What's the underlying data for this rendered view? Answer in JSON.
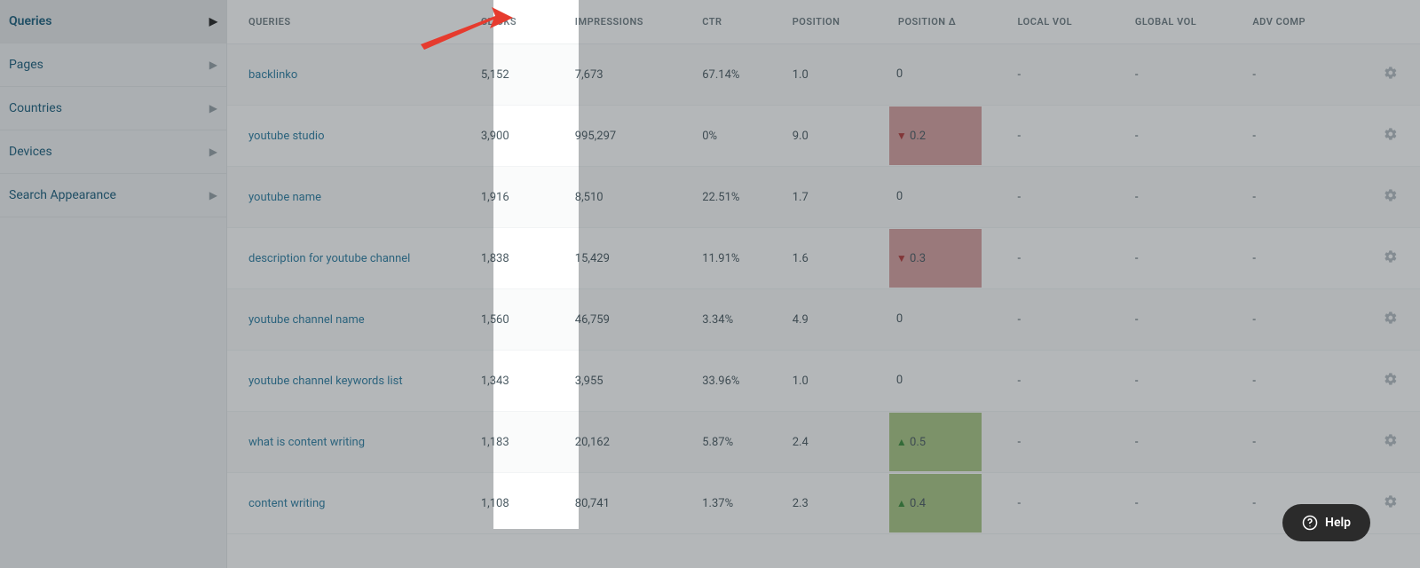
{
  "sidebar": {
    "items": [
      {
        "label": "Queries",
        "active": true
      },
      {
        "label": "Pages",
        "active": false
      },
      {
        "label": "Countries",
        "active": false
      },
      {
        "label": "Devices",
        "active": false
      },
      {
        "label": "Search Appearance",
        "active": false
      }
    ]
  },
  "table": {
    "headers": {
      "queries": "QUERIES",
      "clicks": "CLICKS",
      "impressions": "IMPRESSIONS",
      "ctr": "CTR",
      "position": "POSITION",
      "position_delta": "POSITION Δ",
      "local_vol": "LOCAL VOL",
      "global_vol": "GLOBAL VOL",
      "adv_comp": "ADV COMP"
    },
    "rows": [
      {
        "query": "backlinko",
        "clicks": "5,152",
        "impressions": "7,673",
        "ctr": "67.14%",
        "position": "1.0",
        "delta": "0",
        "delta_dir": "flat",
        "local": "-",
        "global": "-",
        "adv": "-"
      },
      {
        "query": "youtube studio",
        "clicks": "3,900",
        "impressions": "995,297",
        "ctr": "0%",
        "position": "9.0",
        "delta": "0.2",
        "delta_dir": "down",
        "local": "-",
        "global": "-",
        "adv": "-"
      },
      {
        "query": "youtube name",
        "clicks": "1,916",
        "impressions": "8,510",
        "ctr": "22.51%",
        "position": "1.7",
        "delta": "0",
        "delta_dir": "flat",
        "local": "-",
        "global": "-",
        "adv": "-"
      },
      {
        "query": "description for youtube channel",
        "clicks": "1,838",
        "impressions": "15,429",
        "ctr": "11.91%",
        "position": "1.6",
        "delta": "0.3",
        "delta_dir": "down",
        "local": "-",
        "global": "-",
        "adv": "-"
      },
      {
        "query": "youtube channel name",
        "clicks": "1,560",
        "impressions": "46,759",
        "ctr": "3.34%",
        "position": "4.9",
        "delta": "0",
        "delta_dir": "flat",
        "local": "-",
        "global": "-",
        "adv": "-"
      },
      {
        "query": "youtube channel keywords list",
        "clicks": "1,343",
        "impressions": "3,955",
        "ctr": "33.96%",
        "position": "1.0",
        "delta": "0",
        "delta_dir": "flat",
        "local": "-",
        "global": "-",
        "adv": "-"
      },
      {
        "query": "what is content writing",
        "clicks": "1,183",
        "impressions": "20,162",
        "ctr": "5.87%",
        "position": "2.4",
        "delta": "0.5",
        "delta_dir": "up",
        "local": "-",
        "global": "-",
        "adv": "-"
      },
      {
        "query": "content writing",
        "clicks": "1,108",
        "impressions": "80,741",
        "ctr": "1.37%",
        "position": "2.3",
        "delta": "0.4",
        "delta_dir": "up",
        "local": "-",
        "global": "-",
        "adv": "-"
      }
    ]
  },
  "help": {
    "label": "Help"
  }
}
